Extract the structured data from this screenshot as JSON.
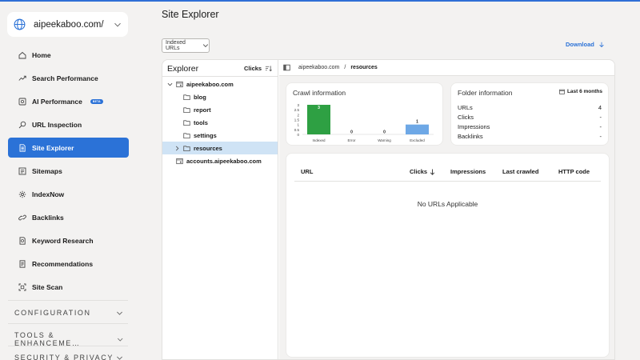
{
  "site": {
    "name": "aipeekaboo.com/"
  },
  "nav": [
    {
      "label": "Home",
      "icon": "home-icon"
    },
    {
      "label": "Search Performance",
      "icon": "trend-icon"
    },
    {
      "label": "AI Performance",
      "icon": "ai-icon",
      "badge": "BETA"
    },
    {
      "label": "URL Inspection",
      "icon": "search-icon"
    },
    {
      "label": "Site Explorer",
      "icon": "document-icon",
      "active": true
    },
    {
      "label": "Sitemaps",
      "icon": "sitemap-icon"
    },
    {
      "label": "IndexNow",
      "icon": "gear-icon"
    },
    {
      "label": "Backlinks",
      "icon": "link-icon"
    },
    {
      "label": "Keyword Research",
      "icon": "doc-search-icon"
    },
    {
      "label": "Recommendations",
      "icon": "checklist-icon"
    },
    {
      "label": "Site Scan",
      "icon": "scan-icon"
    }
  ],
  "sections": {
    "configuration": "CONFIGURATION",
    "tools": "TOOLS & ENHANCEME…",
    "security": "SECURITY & PRIVACY"
  },
  "header": {
    "title": "Site Explorer",
    "filter": "Indexed URLs",
    "download": "Download"
  },
  "explorer": {
    "title": "Explorer",
    "sort_label": "Clicks",
    "tree": [
      {
        "label": "aipeekaboo.com",
        "type": "site",
        "expanded": true
      },
      {
        "label": "blog",
        "type": "folder"
      },
      {
        "label": "report",
        "type": "folder"
      },
      {
        "label": "tools",
        "type": "folder"
      },
      {
        "label": "settings",
        "type": "folder"
      },
      {
        "label": "resources",
        "type": "folder",
        "selected": true,
        "collapsed": true
      },
      {
        "label": "accounts.aipeekaboo.com",
        "type": "site"
      }
    ]
  },
  "breadcrumb": {
    "root": "aipeekaboo.com",
    "separator": "/",
    "current": "resources"
  },
  "crawl": {
    "title": "Crawl information"
  },
  "chart_data": {
    "type": "bar",
    "categories": [
      "Indexed",
      "Error",
      "Warning",
      "Excluded"
    ],
    "values": [
      3,
      0,
      0,
      1
    ],
    "data_labels": [
      "3",
      "0",
      "0",
      "1"
    ],
    "yticks": [
      "3",
      "2.5",
      "2",
      "1.5",
      "1",
      "0.5",
      "0"
    ],
    "ylim": [
      0,
      3
    ],
    "colors": [
      "#2ea043",
      "#d13438",
      "#f2c811",
      "#6ea8e6"
    ],
    "title": "",
    "xlabel": "",
    "ylabel": "",
    "grid": false
  },
  "folder": {
    "title": "Folder information",
    "period": "Last 6 months",
    "rows": [
      {
        "label": "URLs",
        "value": "4"
      },
      {
        "label": "Clicks",
        "value": "-"
      },
      {
        "label": "Impressions",
        "value": "-"
      },
      {
        "label": "Backlinks",
        "value": "-"
      }
    ]
  },
  "table": {
    "columns": [
      "URL",
      "Clicks",
      "Impressions",
      "Last crawled",
      "HTTP code"
    ],
    "empty": "No URLs Applicable"
  }
}
